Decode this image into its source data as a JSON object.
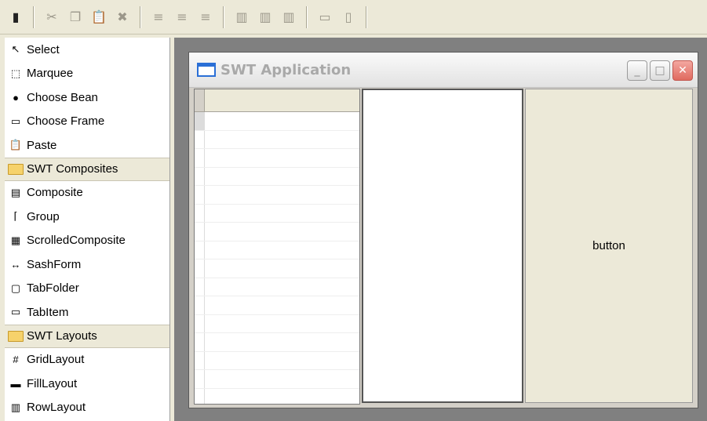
{
  "palette": {
    "items_top": [
      {
        "label": "Select",
        "icon": "arrow-cursor-icon"
      },
      {
        "label": "Marquee",
        "icon": "marquee-icon"
      },
      {
        "label": "Choose Bean",
        "icon": "bean-icon"
      },
      {
        "label": "Choose Frame",
        "icon": "frame-icon"
      },
      {
        "label": "Paste",
        "icon": "paste-icon"
      }
    ],
    "categories": [
      {
        "label": "SWT Composites"
      },
      {
        "label": "SWT Layouts"
      }
    ],
    "composites": [
      {
        "label": "Composite",
        "icon": "composite-icon"
      },
      {
        "label": "Group",
        "icon": "group-icon"
      },
      {
        "label": "ScrolledComposite",
        "icon": "scrolled-composite-icon"
      },
      {
        "label": "SashForm",
        "icon": "sash-form-icon"
      },
      {
        "label": "TabFolder",
        "icon": "tab-folder-icon"
      },
      {
        "label": "TabItem",
        "icon": "tab-item-icon"
      }
    ],
    "layouts": [
      {
        "label": "GridLayout",
        "icon": "grid-layout-icon"
      },
      {
        "label": "FillLayout",
        "icon": "fill-layout-icon"
      },
      {
        "label": "RowLayout",
        "icon": "row-layout-icon"
      }
    ]
  },
  "window": {
    "title": "SWT Application",
    "button_label": "button"
  },
  "colors": {
    "canvas": "#808080",
    "titlebar_text": "#a9a9a9",
    "close_button": "#e06a5f"
  }
}
